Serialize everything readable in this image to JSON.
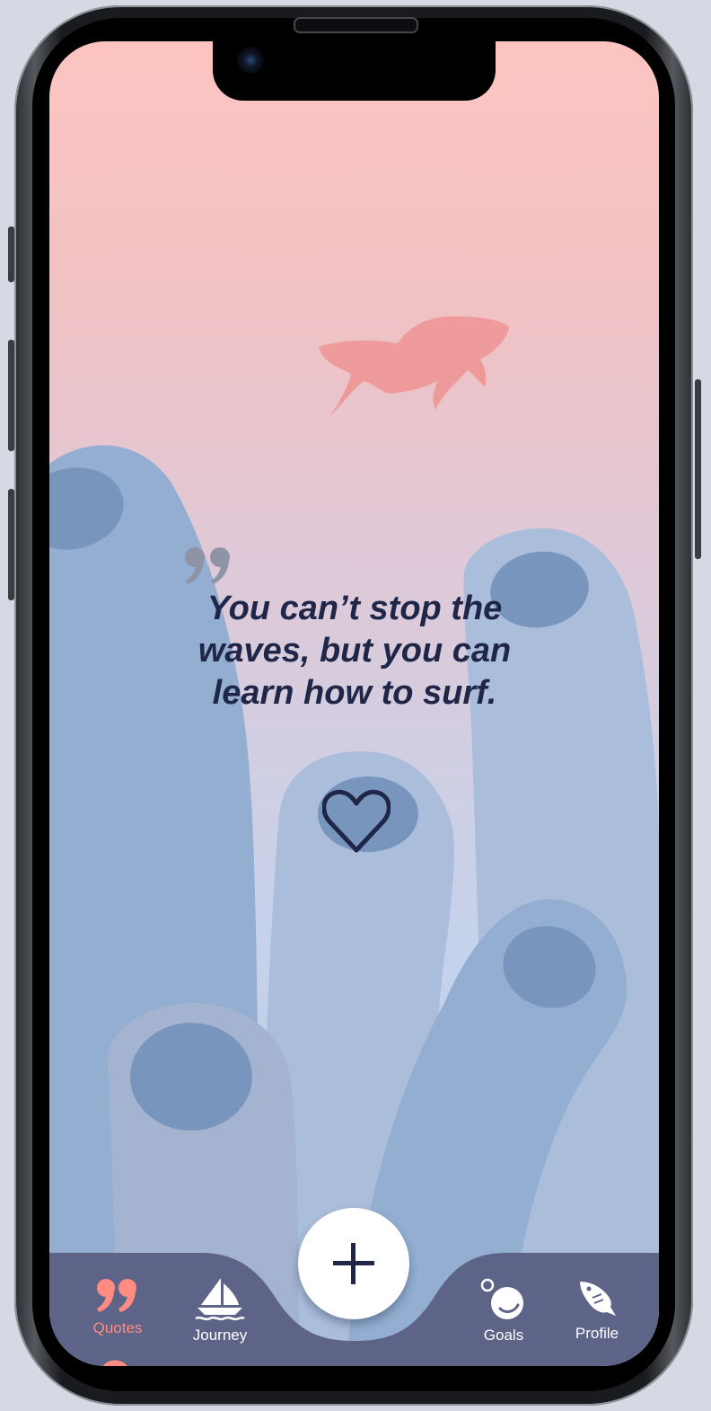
{
  "quote": {
    "text": "You can’t stop the waves, but you can learn how to surf."
  },
  "nav": {
    "tabs": [
      {
        "label": "Quotes",
        "icon": "quotes-icon",
        "active": true
      },
      {
        "label": "Journey",
        "icon": "sailboat-icon",
        "active": false
      },
      {
        "label": "Goals",
        "icon": "bubbles-icon",
        "active": false
      },
      {
        "label": "Profile",
        "icon": "fish-icon",
        "active": false
      }
    ],
    "add_button": {
      "icon": "plus-icon"
    }
  },
  "colors": {
    "accent": "#ff8c82",
    "tab_bar": "#5d6488",
    "quote_text": "#1f2648",
    "fish": "#ee9696",
    "coral_light": "#aabdda",
    "coral_mid": "#93aed0",
    "coral_hole": "#7895bd"
  }
}
